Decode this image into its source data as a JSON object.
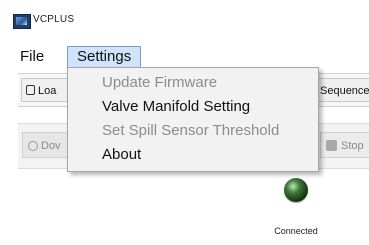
{
  "window": {
    "title": "VCPLUS",
    "app_icon": "app-icon"
  },
  "menubar": {
    "items": [
      {
        "label": "File"
      },
      {
        "label": "Settings",
        "state": "open"
      }
    ]
  },
  "toolbar": {
    "load_label": "Loa",
    "sequence_label": "Sequence"
  },
  "controls": {
    "download_label": "Dov",
    "stop_label": "Stop"
  },
  "status": {
    "label": "Connected",
    "indicator_color": "#2e6b2a"
  },
  "settings_menu": {
    "items": [
      {
        "label": "Update Firmware",
        "enabled": false
      },
      {
        "label": "Valve Manifold Setting",
        "enabled": true
      },
      {
        "label": "Set Spill Sensor Threshold",
        "enabled": false
      },
      {
        "label": "About",
        "enabled": true
      }
    ]
  },
  "colors": {
    "menu_highlight": "#cfe3fb",
    "menu_highlight_border": "#7a9cc9",
    "dropdown_bg": "#f2f2f2",
    "disabled_text": "#8c8c8c"
  }
}
